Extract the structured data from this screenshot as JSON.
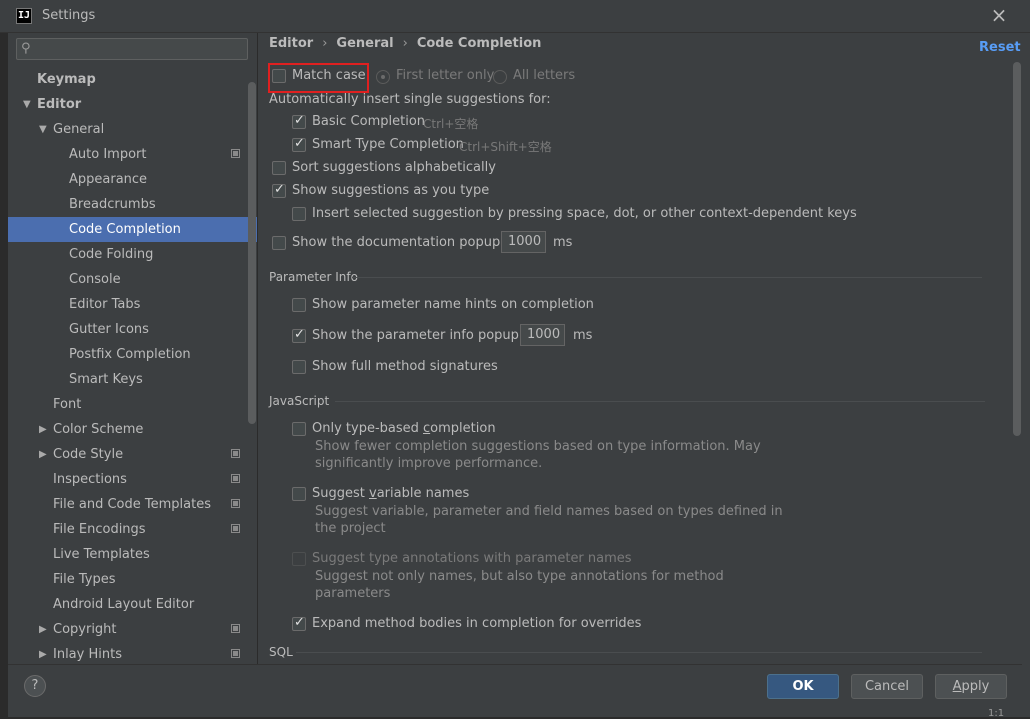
{
  "window": {
    "title": "Settings",
    "app_icon_text": "IJ"
  },
  "sidebar": {
    "search_placeholder": "",
    "items": [
      {
        "label": "Keymap",
        "level": 0,
        "bold": true
      },
      {
        "label": "Editor",
        "level": 0,
        "bold": true,
        "arrow": "▼"
      },
      {
        "label": "General",
        "level": 1,
        "arrow": "▼"
      },
      {
        "label": "Auto Import",
        "level": 2,
        "copy": true
      },
      {
        "label": "Appearance",
        "level": 2
      },
      {
        "label": "Breadcrumbs",
        "level": 2
      },
      {
        "label": "Code Completion",
        "level": 2,
        "selected": true
      },
      {
        "label": "Code Folding",
        "level": 2
      },
      {
        "label": "Console",
        "level": 2
      },
      {
        "label": "Editor Tabs",
        "level": 2
      },
      {
        "label": "Gutter Icons",
        "level": 2
      },
      {
        "label": "Postfix Completion",
        "level": 2
      },
      {
        "label": "Smart Keys",
        "level": 2
      },
      {
        "label": "Font",
        "level": 1
      },
      {
        "label": "Color Scheme",
        "level": 1,
        "arrow": "▶"
      },
      {
        "label": "Code Style",
        "level": 1,
        "arrow": "▶",
        "copy": true
      },
      {
        "label": "Inspections",
        "level": 1,
        "copy": true
      },
      {
        "label": "File and Code Templates",
        "level": 1,
        "copy": true
      },
      {
        "label": "File Encodings",
        "level": 1,
        "copy": true
      },
      {
        "label": "Live Templates",
        "level": 1
      },
      {
        "label": "File Types",
        "level": 1
      },
      {
        "label": "Android Layout Editor",
        "level": 1
      },
      {
        "label": "Copyright",
        "level": 1,
        "arrow": "▶",
        "copy": true
      },
      {
        "label": "Inlay Hints",
        "level": 1,
        "arrow": "▶",
        "copy": true
      }
    ]
  },
  "breadcrumb": {
    "part1": "Editor",
    "part2": "General",
    "part3": "Code Completion",
    "separator": "›"
  },
  "reset_label": "Reset",
  "match_case": {
    "label": "Match case:",
    "checked": false,
    "radio1": "First letter only",
    "radio2": "All letters"
  },
  "auto_insert_label": "Automatically insert single suggestions for:",
  "basic_completion": {
    "label": "Basic Completion",
    "hint": "Ctrl+空格",
    "checked": true
  },
  "smart_type_completion": {
    "label": "Smart Type Completion",
    "hint": "Ctrl+Shift+空格",
    "checked": true
  },
  "sort_alpha": {
    "label": "Sort suggestions alphabetically",
    "checked": false
  },
  "show_as_type": {
    "label": "Show suggestions as you type",
    "checked": true
  },
  "insert_selected": {
    "label": "Insert selected suggestion by pressing space, dot, or other context-dependent keys",
    "checked": false
  },
  "doc_popup": {
    "label": "Show the documentation popup in",
    "value": "1000",
    "unit": "ms",
    "checked": false
  },
  "parameter_info": {
    "title": "Parameter Info",
    "name_hints": {
      "label": "Show parameter name hints on completion",
      "checked": false
    },
    "info_popup": {
      "label": "Show the parameter info popup in",
      "value": "1000",
      "unit": "ms",
      "checked": true
    },
    "full_signatures": {
      "label": "Show full method signatures",
      "checked": false
    }
  },
  "javascript": {
    "title": "JavaScript",
    "type_based": {
      "label_pre": "Only type-based ",
      "label_u": "c",
      "label_post": "ompletion",
      "desc1": "Show fewer completion suggestions based on type information. May",
      "desc2": "significantly improve performance.",
      "checked": false
    },
    "var_names": {
      "label_pre": "Suggest ",
      "label_u": "v",
      "label_post": "ariable names",
      "desc1": "Suggest variable, parameter and field names based on types defined in",
      "desc2": "the project",
      "checked": false
    },
    "type_annotations": {
      "label": "Suggest type annotations with parameter names",
      "desc1": "Suggest not only names, but also type annotations for method",
      "desc2": "parameters",
      "checked": false,
      "disabled": true
    },
    "expand_bodies": {
      "label": "Expand method bodies in completion for overrides",
      "checked": true
    }
  },
  "sql": {
    "title": "SQL"
  },
  "buttons": {
    "help": "?",
    "ok": "OK",
    "cancel": "Cancel",
    "apply_pre": "",
    "apply_u": "A",
    "apply_post": "pply"
  },
  "status": "1:1"
}
